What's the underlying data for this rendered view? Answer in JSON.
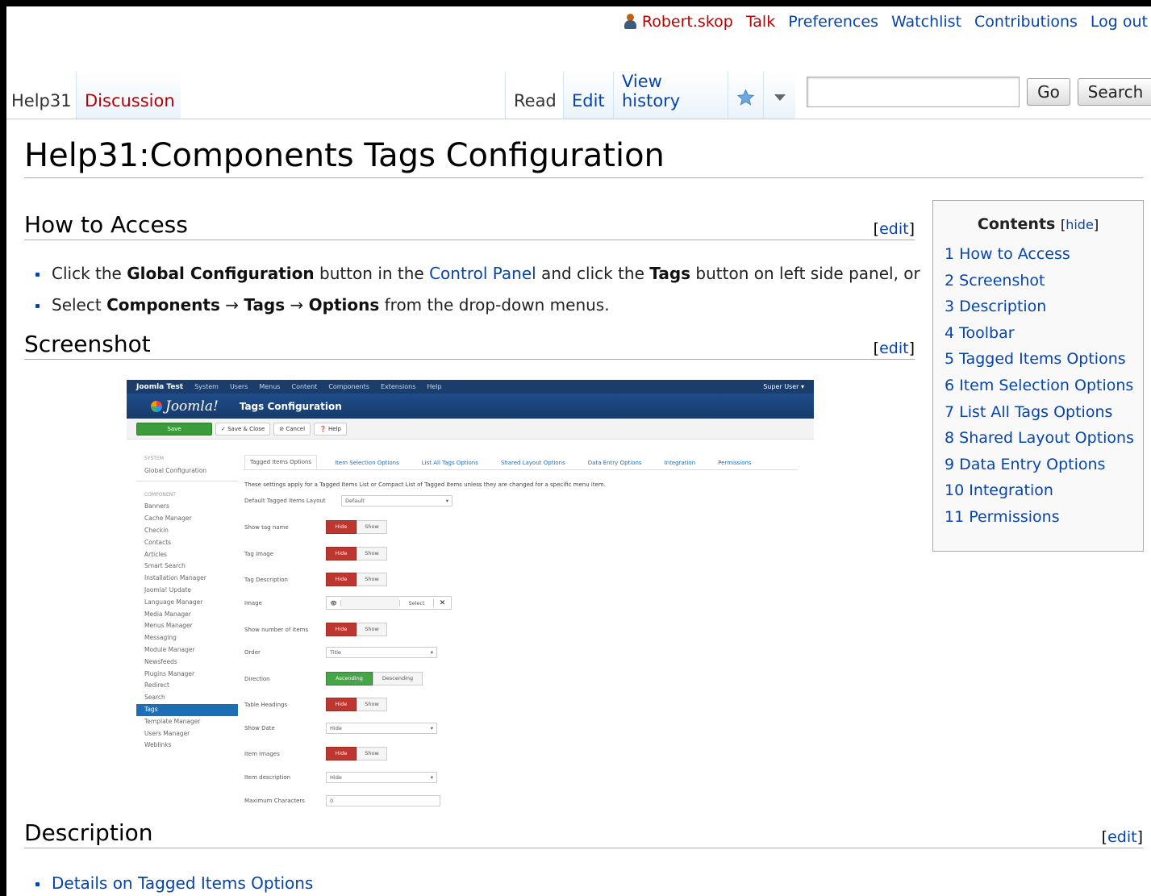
{
  "personal": {
    "user": "Robert.skop",
    "links": [
      "Talk",
      "Preferences",
      "Watchlist",
      "Contributions",
      "Log out"
    ]
  },
  "tabs": {
    "page": "Help31",
    "discussion": "Discussion",
    "read": "Read",
    "edit": "Edit",
    "history": "View history"
  },
  "search": {
    "go": "Go",
    "search": "Search",
    "value": ""
  },
  "title": "Help31:Components Tags Configuration",
  "edit_label": "edit",
  "sections": {
    "access": "How to Access",
    "screenshot": "Screenshot",
    "description": "Description"
  },
  "access": {
    "l1": [
      "Click the ",
      "Global Configuration",
      " button in the ",
      "Control Panel",
      " and click the ",
      "Tags",
      " button on left side panel, or"
    ],
    "l2": [
      "Select ",
      "Components",
      " → ",
      "Tags",
      " → ",
      "Options",
      " from the drop-down menus."
    ]
  },
  "description_link": "Details on Tagged Items Options",
  "toc": {
    "title": "Contents",
    "hide": "hide",
    "items": [
      "1 How to Access",
      "2 Screenshot",
      "3 Description",
      "4 Toolbar",
      "5 Tagged Items Options",
      "6 Item Selection Options",
      "7 List All Tags Options",
      "8 Shared Layout Options",
      "9 Data Entry Options",
      "10 Integration",
      "11 Permissions"
    ]
  },
  "shot": {
    "brand": "Joomla Test",
    "menu": [
      "System",
      "Users",
      "Menus",
      "Content",
      "Components",
      "Extensions",
      "Help"
    ],
    "super_user": "Super User ▾",
    "logo": "Joomla!",
    "header_title": "Tags Configuration",
    "toolbar": [
      "Save",
      "✓ Save & Close",
      "⊘ Cancel",
      "❓ Help"
    ],
    "sidebar": {
      "system": "System",
      "global": "Global Configuration",
      "component": "Component",
      "items": [
        "Banners",
        "Cache Manager",
        "Checkin",
        "Contacts",
        "Articles",
        "Smart Search",
        "Installation Manager",
        "Joomla! Update",
        "Language Manager",
        "Media Manager",
        "Menus Manager",
        "Messaging",
        "Module Manager",
        "Newsfeeds",
        "Plugins Manager",
        "Redirect",
        "Search",
        "Tags",
        "Template Manager",
        "Users Manager",
        "Weblinks"
      ]
    },
    "tabs": [
      "Tagged Items Options",
      "Item Selection Options",
      "List All Tags Options",
      "Shared Layout Options",
      "Data Entry Options",
      "Integration",
      "Permissions"
    ],
    "intro": "These settings apply for a Tagged Items List or Compact List of Tagged Items unless they are changed for a specific menu item.",
    "layout_label": "Default Tagged Items Layout",
    "layout_value": "Default",
    "hide": "Hide",
    "show": "Show",
    "rows": {
      "tag_name": "Show tag name",
      "tag_image": "Tag Image",
      "tag_desc": "Tag Description",
      "image": "Image",
      "num_items": "Show number of items",
      "order": "Order",
      "direction": "Direction",
      "table_headings": "Table Headings",
      "show_date": "Show Date",
      "item_images": "Item Images",
      "item_desc": "Item description",
      "max_chars": "Maximum Characters"
    },
    "order_value": "Title",
    "ascending": "Ascending",
    "descending": "Descending",
    "date_value": "Hide",
    "desc_value": "Hide",
    "max_value": "0",
    "select": "Select",
    "x": "✕"
  }
}
